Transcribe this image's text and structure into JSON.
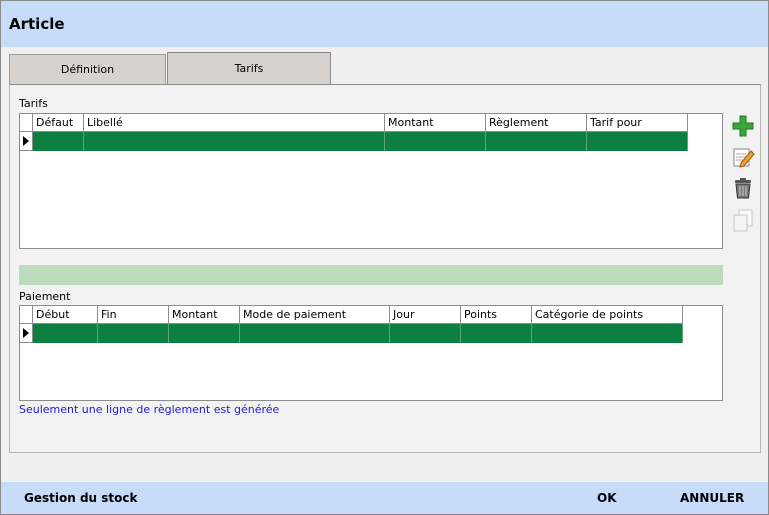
{
  "window": {
    "title": "Article"
  },
  "tabs": [
    {
      "label": "Définition",
      "active": false
    },
    {
      "label": "Tarifs",
      "active": true
    }
  ],
  "tarifs": {
    "section_label": "Tarifs",
    "columns": [
      "Défaut",
      "Libellé",
      "Montant",
      "Règlement",
      "Tarif pour"
    ],
    "rows": [
      [
        "",
        "",
        "",
        "",
        ""
      ]
    ]
  },
  "paiement": {
    "section_label": "Paiement",
    "columns": [
      "Début",
      "Fin",
      "Montant",
      "Mode de paiement",
      "Jour",
      "Points",
      "Catégorie de points"
    ],
    "rows": [
      [
        "",
        "",
        "",
        "",
        "",
        "",
        ""
      ]
    ],
    "note": "Seulement une ligne de règlement est générée"
  },
  "actions": {
    "add_icon": "plus-icon",
    "edit_icon": "edit-icon",
    "delete_icon": "trash-icon",
    "duplicate_icon": "copy-icon"
  },
  "footer": {
    "stock_label": "Gestion du stock",
    "ok_label": "OK",
    "cancel_label": "ANNULER"
  },
  "colors": {
    "titlebar": "#c6dcf8",
    "selected_row": "#0c8040",
    "separator": "#bddbbd",
    "note_text": "#1c1ccf"
  }
}
